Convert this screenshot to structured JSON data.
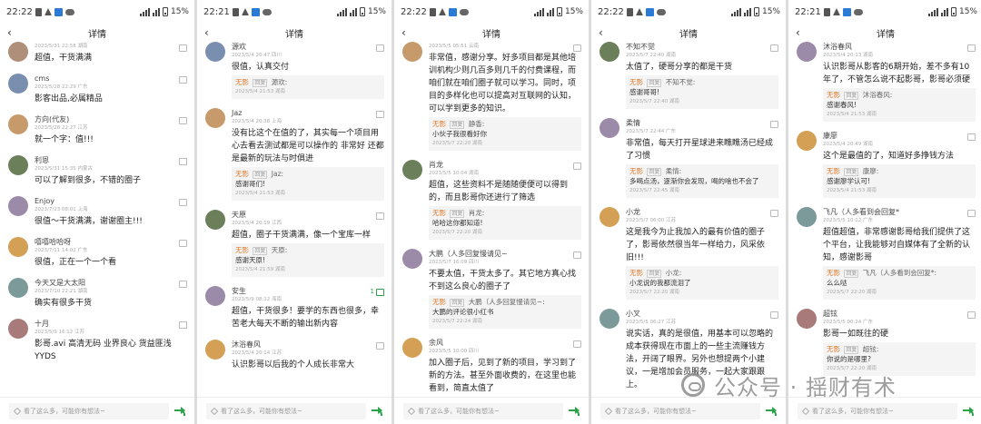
{
  "panels": [
    {
      "status": {
        "time": "22:22",
        "battery": "15%"
      },
      "title": "详情",
      "comments": [
        {
          "name": "",
          "meta": "2023/5/31 22:58  湖南",
          "text": "超值，干货满满",
          "likes": ""
        },
        {
          "name": "cms",
          "meta": "2023/5/28 22:29  广东",
          "text": "影客出品,必属精品",
          "likes": ""
        },
        {
          "name": "方向(代友)",
          "meta": "2023/5/28 22:27  江苏",
          "text": "就一个字：值!!!",
          "likes": ""
        },
        {
          "name": "利恩",
          "meta": "2023/5/31 15:35  内蒙古",
          "text": "可以了解到很多，不错的圈子",
          "likes": ""
        },
        {
          "name": "Enjoy",
          "meta": "2023/7/23 08:01  上海",
          "text": "很值～干货满满，谢谢圈主!!!",
          "likes": ""
        },
        {
          "name": "嘻嘻哈哈呀",
          "meta": "2023/7/11 14:02  广东",
          "text": "很值，正在一个一个看",
          "likes": ""
        },
        {
          "name": "今天又是大太阳",
          "meta": "2023/7/10 22:21  湖南",
          "text": "确实有很多干货",
          "likes": ""
        },
        {
          "name": "十月",
          "meta": "2023/5/9 16:12  江苏",
          "text": "影哥.avi 高清无码 业界良心 货益匪浅 YYDS",
          "likes": ""
        }
      ],
      "bottom_placeholder": "看了这么多，可能你有想法~"
    },
    {
      "status": {
        "time": "22:21",
        "battery": "15%"
      },
      "title": "详情",
      "comments": [
        {
          "name": "源欢",
          "meta": "2023/5/4 20:47  四川",
          "text": "很值，认真交付",
          "likes": "",
          "reply": {
            "author": "无影",
            "tag": "回复",
            "target": "源欢:",
            "text": "",
            "meta": "2023/5/4 21:53  湖南"
          }
        },
        {
          "name": "Jaz",
          "meta": "2023/5/4 20:38  上海",
          "text": "没有比这个在值的了，其实每一个项目用心去看去测试都是可以操作的 非常好 还都是最新的玩法与时俱进",
          "likes": "",
          "reply": {
            "author": "无影",
            "tag": "回复",
            "target": "Jaz:",
            "text": "感谢哥们!",
            "meta": "2023/5/4 21:53  湖南"
          }
        },
        {
          "name": "天原",
          "meta": "2023/5/4 20:19  江西",
          "text": "超值，圈子干货满满，像一个宝库一样",
          "likes": "",
          "reply": {
            "author": "无影",
            "tag": "回复",
            "target": "天原:",
            "text": "感谢天原!",
            "meta": "2023/5/4 21:59  湖南"
          }
        },
        {
          "name": "安生",
          "meta": "2023/5/9 08:12  海南",
          "text": "超值，干货很多！要学的东西也很多，幸苦老大每天不断的输出新内容",
          "likes": "1"
        },
        {
          "name": "沐浴春风",
          "meta": "2023/5/4 20:14  江苏",
          "text": "认识影哥以后我的个人成长非常大",
          "likes": ""
        }
      ],
      "bottom_placeholder": "看了这么多，可能你有想法~"
    },
    {
      "status": {
        "time": "22:22",
        "battery": "15%"
      },
      "title": "详情",
      "comments": [
        {
          "name": "",
          "meta": "2023/5/5 05:51  云南",
          "text": "非常值，感谢分享。好多项目都是其他培训机构少则几百多则几千的付费课程，而咱们就在咱们圈子就可以学习。同时，项目的多样化也可以提高对互联网的认知，可以学到更多的知识。",
          "likes": "",
          "reply": {
            "author": "无影",
            "tag": "回复",
            "target": "静香:",
            "text": "小伙子我很看好你",
            "meta": "2023/5/7 22:20  湖南"
          }
        },
        {
          "name": "肖龙",
          "meta": "2023/5/5 10:04  湖南",
          "text": "超值，这些资料不是随随便便可以得到的，而且影哥你还进行了筛选",
          "likes": "",
          "reply": {
            "author": "无影",
            "tag": "回复",
            "target": "肖龙:",
            "text": "哈哈这你都知道!",
            "meta": "2023/5/7 22:20  湖南"
          }
        },
        {
          "name": "大鹏（人多回复慢请见~",
          "meta": "2023/5/7 16:09  四川",
          "text": "不要太值，干货太多了。其它地方真心找不到这么良心的圈子了",
          "likes": "",
          "reply": {
            "author": "无影",
            "tag": "回复",
            "target": "大鹏（人多回复慢请见~:",
            "text": "大鹏的评论很小红书",
            "meta": "2023/5/7 22:24  湖南"
          }
        },
        {
          "name": "余风",
          "meta": "2023/5/5 10:00  四川",
          "text": "加入圈子后，见到了新的项目，学习到了新的方法。甚至外面收费的，在这里也能看到，简直太值了",
          "likes": ""
        }
      ],
      "bottom_placeholder": "看了这么多，可能你有想法~"
    },
    {
      "status": {
        "time": "22:22",
        "battery": "15%"
      },
      "title": "详情",
      "comments": [
        {
          "name": "不知不觉",
          "meta": "2023/5/7 22:40  湖南",
          "text": "太值了，硬哥分享的都是干货",
          "likes": "",
          "reply": {
            "author": "无影",
            "tag": "回复",
            "target": "不知不觉:",
            "text": "感谢哥哥!",
            "meta": "2023/5/7 22:40  湖南"
          }
        },
        {
          "name": "柔情",
          "meta": "2023/5/7 22:44  广东",
          "text": "非常值，每天打开星球进来瞧瞧汤已经成了习惯",
          "likes": "",
          "reply": {
            "author": "无影",
            "tag": "回复",
            "target": "柔情:",
            "text": "多喝点汤，逐渐你会发现，喝的啥也不会了",
            "meta": "2023/5/7 22:45  湖南"
          }
        },
        {
          "name": "小龙",
          "meta": "2023/5/7 06:00  江苏",
          "text": "这是我今为止我加入的最有价值的圈子了，影哥依然很当年一样给力，风采依旧!!!",
          "likes": "",
          "reply": {
            "author": "无影",
            "tag": "回复",
            "target": "小龙:",
            "text": "小龙说的我都流泪了",
            "meta": "2023/5/7 22:20  湖南"
          }
        },
        {
          "name": "小叉",
          "meta": "2023/5/5 06:27  江苏",
          "text": "说实话，真的是很值，用基本可以忽略的成本获得现在市面上的一些主流赚钱方法，开阔了眼界。另外也想提两个小建议，一是增加会员服务，一起大家跟跟上。",
          "likes": ""
        }
      ],
      "bottom_placeholder": "看了这么多，可能你有想法~"
    },
    {
      "status": {
        "time": "22:21",
        "battery": "15%"
      },
      "title": "详情",
      "comments": [
        {
          "name": "沐浴春风",
          "meta": "2023/5/4 20:13  湖南",
          "text": "认识影哥从影客的6期开始，差不多有10年了，不管怎么说不起影哥，影哥必须硬",
          "likes": "",
          "reply": {
            "author": "无影",
            "tag": "回复",
            "target": "沐浴春风:",
            "text": "感谢春风!",
            "meta": "2023/5/4 21:53  湖南"
          }
        },
        {
          "name": "康廖",
          "meta": "2023/5/4 20:49  湖南",
          "text": "这个是最值的了，知道好多挣钱方法",
          "likes": "",
          "reply": {
            "author": "无影",
            "tag": "回复",
            "target": "康廖:",
            "text": "感谢廖学认可!",
            "meta": "2023/5/4 21:53  湖南"
          }
        },
        {
          "name": "飞凡（人多看到会回复*",
          "meta": "2023/5/5 10:12  广东",
          "text": "超值超值，非常感谢影哥给我们提供了这个平台，让我能够对自媒体有了全新的认知，感谢影哥",
          "likes": "",
          "reply": {
            "author": "无影",
            "tag": "回复",
            "target": "飞凡（人多看到会回复*:",
            "text": "么么哒",
            "meta": "2023/5/7 22:20  湖南"
          }
        },
        {
          "name": "超铉",
          "meta": "2023/5/5 00:24  广东",
          "text": "影哥一如既往的硬",
          "likes": "",
          "reply": {
            "author": "无影",
            "tag": "回复",
            "target": "超铉:",
            "text": "你说的是哪里?",
            "meta": "2023/5/7 22:20  湖南"
          }
        }
      ],
      "bottom_placeholder": "看了这么多，可能你有想法~"
    }
  ],
  "watermark": {
    "text": "公众号 · 揺财有术"
  },
  "colors": {
    "reply_author": "#e07a2a",
    "like_active": "#2aa34a",
    "background": "#ffffff"
  }
}
